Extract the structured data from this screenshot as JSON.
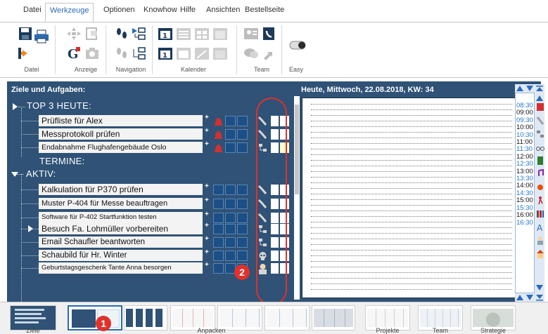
{
  "menu": {
    "tabs": [
      {
        "label": "Datei"
      },
      {
        "label": "Werkzeuge"
      },
      {
        "label": "Optionen"
      },
      {
        "label": "Knowhow"
      },
      {
        "label": "Hilfe"
      },
      {
        "label": "Ansichten"
      },
      {
        "label": "Bestellseite"
      }
    ],
    "active": "Werkzeuge"
  },
  "ribbon": {
    "groups": [
      {
        "label": "Datei"
      },
      {
        "label": "Anzeige"
      },
      {
        "label": "Navigation"
      },
      {
        "label": "Kalender"
      },
      {
        "label": "Team"
      },
      {
        "label": "Easy"
      }
    ]
  },
  "panel": {
    "left_header": "Ziele und Aufgaben:",
    "right_header": "Heute, Mittwoch, 22.08.2018, KW: 34",
    "sections": {
      "top3": "TOP 3 HEUTE:",
      "termine": "TERMINE:",
      "aktiv": "AKTIV:"
    },
    "top3_tasks": [
      "Prüfliste für Alex",
      "Messprotokoll prüfen",
      "Endabnahme Flughafengebäude Oslo"
    ],
    "aktiv_tasks": [
      "Kalkulation für P370 prüfen",
      "Muster P-404 für Messe beauftragen",
      "Software für P-402 Startfunktion testen",
      "Besuch Fa. Lohmüller vorbereiten",
      "Email Schaufler beantworten",
      "Schaubild für Hr. Winter",
      "Geburtstagsgeschenk Tante Anna besorgen"
    ],
    "plus_symbol": "+"
  },
  "times": [
    {
      "t": "08:30",
      "c": "#2479c9"
    },
    {
      "t": "09:00",
      "c": "#111111"
    },
    {
      "t": "09:30",
      "c": "#2479c9"
    },
    {
      "t": "10:00",
      "c": "#111111"
    },
    {
      "t": "10:30",
      "c": "#2479c9"
    },
    {
      "t": "11:00",
      "c": "#111111"
    },
    {
      "t": "11:30",
      "c": "#2479c9"
    },
    {
      "t": "12:00",
      "c": "#111111"
    },
    {
      "t": "12:30",
      "c": "#2479c9"
    },
    {
      "t": "13:00",
      "c": "#111111"
    },
    {
      "t": "13:30",
      "c": "#2479c9"
    },
    {
      "t": "14:00",
      "c": "#111111"
    },
    {
      "t": "14:30",
      "c": "#2479c9"
    },
    {
      "t": "15:00",
      "c": "#111111"
    },
    {
      "t": "15:30",
      "c": "#2479c9"
    },
    {
      "t": "16:00",
      "c": "#111111"
    },
    {
      "t": "16:30",
      "c": "#2479c9"
    }
  ],
  "annotations": {
    "badge1": "1",
    "badge2": "2"
  },
  "strip": {
    "labels": [
      "Ziele",
      "Anpacken",
      "Projekte",
      "Team",
      "Strategie"
    ]
  },
  "colors": {
    "panel_bg": "#2f5276",
    "accent_blue": "#2a6ab8",
    "annotation_red": "#e0312b"
  }
}
